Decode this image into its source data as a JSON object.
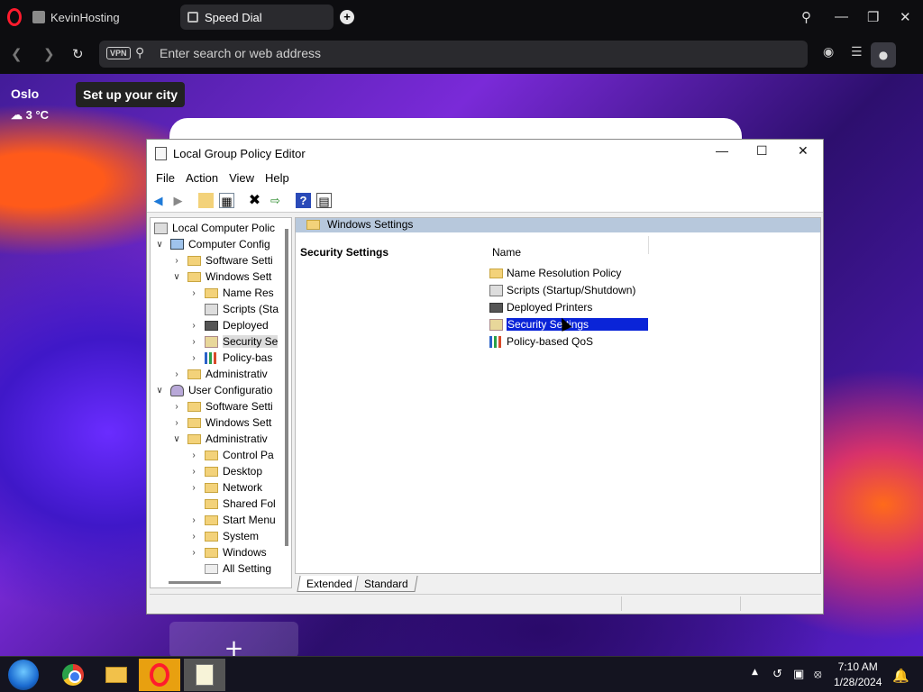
{
  "browser": {
    "tabs": [
      {
        "label": "KevinHosting"
      },
      {
        "label": "Speed Dial"
      }
    ],
    "address_placeholder": "Enter search or web address",
    "vpn_label": "VPN"
  },
  "weather": {
    "city": "Oslo",
    "temp": "3 °C",
    "setup_label": "Set up your city"
  },
  "gpedit": {
    "title": "Local Group Policy Editor",
    "menu": [
      "File",
      "Action",
      "Help",
      "View"
    ],
    "menu_ordered": {
      "file": "File",
      "action": "Action",
      "view": "View",
      "help": "Help"
    },
    "tree": [
      {
        "label": "Local Computer Polic"
      },
      {
        "label": "Computer Config"
      },
      {
        "label": "Software Setti"
      },
      {
        "label": "Windows Sett"
      },
      {
        "label": "Name Res"
      },
      {
        "label": "Scripts (Sta"
      },
      {
        "label": "Deployed"
      },
      {
        "label": "Security Se"
      },
      {
        "label": "Policy-bas"
      },
      {
        "label": "Administrativ"
      },
      {
        "label": "User Configuratio"
      },
      {
        "label": "Software Setti"
      },
      {
        "label": "Windows Sett"
      },
      {
        "label": "Administrativ"
      },
      {
        "label": "Control Pa"
      },
      {
        "label": "Desktop"
      },
      {
        "label": "Network"
      },
      {
        "label": "Shared Fol"
      },
      {
        "label": "Start Menu"
      },
      {
        "label": "System"
      },
      {
        "label": "Windows"
      },
      {
        "label": "All Setting"
      }
    ],
    "pane_header": "Windows Settings",
    "pane_title": "Security Settings",
    "column_name": "Name",
    "items": [
      {
        "label": "Name Resolution Policy"
      },
      {
        "label": "Scripts (Startup/Shutdown)"
      },
      {
        "label": "Deployed Printers"
      },
      {
        "label": "Security Settings"
      },
      {
        "label": "Policy-based QoS"
      }
    ],
    "view_tabs": [
      "Extended",
      "Standard"
    ]
  },
  "taskbar": {
    "time": "7:10 AM",
    "date": "1/28/2024"
  },
  "colors": {
    "selection": "#0a24d8",
    "header_band": "#b7c8dc",
    "opera_red": "#ff1b2d"
  }
}
